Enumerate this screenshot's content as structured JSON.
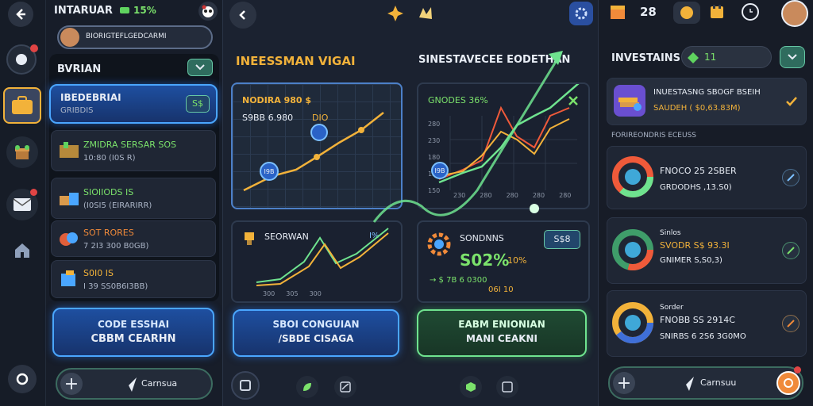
{
  "top_bar": {
    "title": "INTARUAR",
    "currency_value": "15%",
    "coins": "28"
  },
  "player": {
    "name": "BIORIGTEFLGEDCARMI"
  },
  "left_panel": {
    "header": "BVRIAN",
    "selected": {
      "title": "IBEDEBRIAI",
      "subtitle": "GRIBDIS",
      "badge": "S$"
    },
    "items": [
      {
        "title": "ZMIDRA SERSAR SOS",
        "subtitle": "10:80 (I0S R)",
        "title_color": "#7be26b"
      },
      {
        "title": "SIOIIODS IS",
        "subtitle": "(I0SI5 (EIRARIRR)",
        "title_color": "#7be26b"
      },
      {
        "title": "SOT RORES",
        "subtitle": "7 2I3 300 B0GB)",
        "title_color": "#f08a3a"
      },
      {
        "title": "S0I0 IS",
        "subtitle": "I 39 SS0B6I3BB)",
        "title_color": "#f2b23a"
      }
    ],
    "primary_button": {
      "line1": "CODE ESSHAI",
      "line2": "CBBM CEARHN"
    },
    "bottom_button": "Carnsua"
  },
  "middle_panel": {
    "title_left": "INEESSMAN VIGAI",
    "title_right": "SINESTAVECEE EODETHAN",
    "chart1": {
      "label1": "NODIRA 980 $",
      "label2": "S9BB 6.980",
      "label3": "DIO",
      "point_label": "I9B"
    },
    "chart2": {
      "title": "GNODES 36%",
      "y_ticks": [
        "280",
        "230",
        "180",
        "150",
        "150"
      ],
      "x_ticks": [
        "230",
        "280",
        "280",
        "280",
        "280"
      ],
      "point_label": "I9B"
    },
    "card3": {
      "title": "SEORWAN",
      "x_ticks": [
        "300",
        "305",
        "300"
      ],
      "corner": "I%"
    },
    "card4": {
      "title": "SONDNNS",
      "badge": "S$8",
      "percent": "S02%",
      "percent_small": "10%",
      "line1": "→ $ 7B 6 0300",
      "line2": "06I 10"
    },
    "button1": {
      "line1": "SBOI CONGUIAN",
      "line2": "/SBDE CISAGA"
    },
    "button2": {
      "line1": "EABM ENIONIAN",
      "line2": "MANI CEAKNI"
    }
  },
  "right_panel": {
    "title": "INVESTAINS",
    "count": "11",
    "featured": {
      "title": "INUESTASNG SBOGF BSEIH",
      "subtitle": "SAUDEH ( $0,63.83M)"
    },
    "section_label": "FORIREONDRIS ECEUSS",
    "items": [
      {
        "title": "FNOCO 25 2SBER",
        "subtitle": "GRDODHS ,13.S0)"
      },
      {
        "title": "Sinlos",
        "line2": "SVODR S$ 93.3I",
        "subtitle": "GNIMER S,S0,3)"
      },
      {
        "title": "Sorder",
        "line2": "FNOBB SS 2914C",
        "subtitle": "SNIRBS 6 2S6 3G0MO"
      }
    ],
    "bottom_button": "Carnsuu"
  },
  "colors": {
    "accent_blue": "#4aa6ff",
    "accent_green": "#6fe38f",
    "gold": "#f2b23a",
    "orange": "#f08a3a"
  }
}
